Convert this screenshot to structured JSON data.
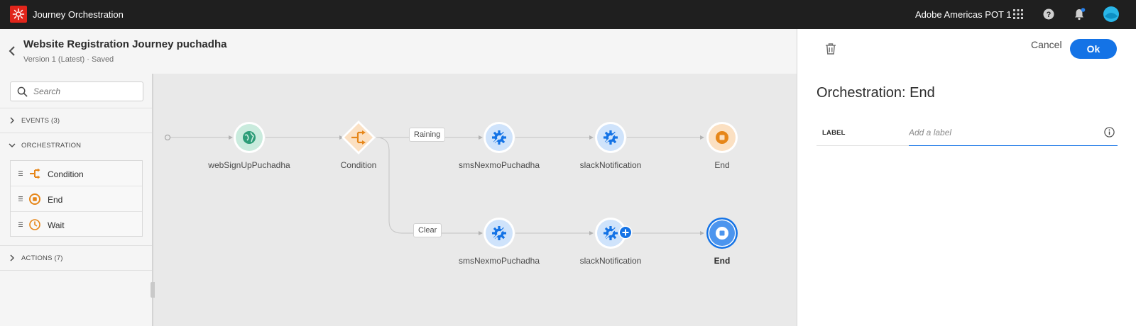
{
  "topbar": {
    "app_title": "Journey Orchestration",
    "org_name": "Adobe Americas POT 1"
  },
  "header": {
    "title": "Website Registration Journey puchadha",
    "subtitle": "Version 1 (Latest) · Saved"
  },
  "left_panel": {
    "search_placeholder": "Search",
    "events_label": "EVENTS (3)",
    "orchestration_label": "ORCHESTRATION",
    "actions_label": "ACTIONS (7)",
    "orchestration_items": [
      {
        "label": "Condition",
        "icon": "condition-icon"
      },
      {
        "label": "End",
        "icon": "end-icon"
      },
      {
        "label": "Wait",
        "icon": "clock-icon"
      }
    ]
  },
  "canvas": {
    "nodes": {
      "event": "webSignUpPuchadha",
      "condition": "Condition",
      "sms_top": "smsNexmoPuchadha",
      "slack_top": "slackNotification",
      "end_top": "End",
      "sms_bottom": "smsNexmoPuchadha",
      "slack_bottom": "slackNotification",
      "end_bottom": "End"
    },
    "paths": {
      "top": "Raining",
      "bottom": "Clear"
    }
  },
  "right_panel": {
    "cancel_label": "Cancel",
    "ok_label": "Ok",
    "title": "Orchestration: End",
    "field_label": "LABEL",
    "field_placeholder": "Add a label",
    "field_value": ""
  },
  "colors": {
    "accent": "#1473e6",
    "topbar": "#1f1f1f",
    "adobe_red": "#e1251b",
    "orange": "#e68619",
    "green": "#2d9d78"
  }
}
